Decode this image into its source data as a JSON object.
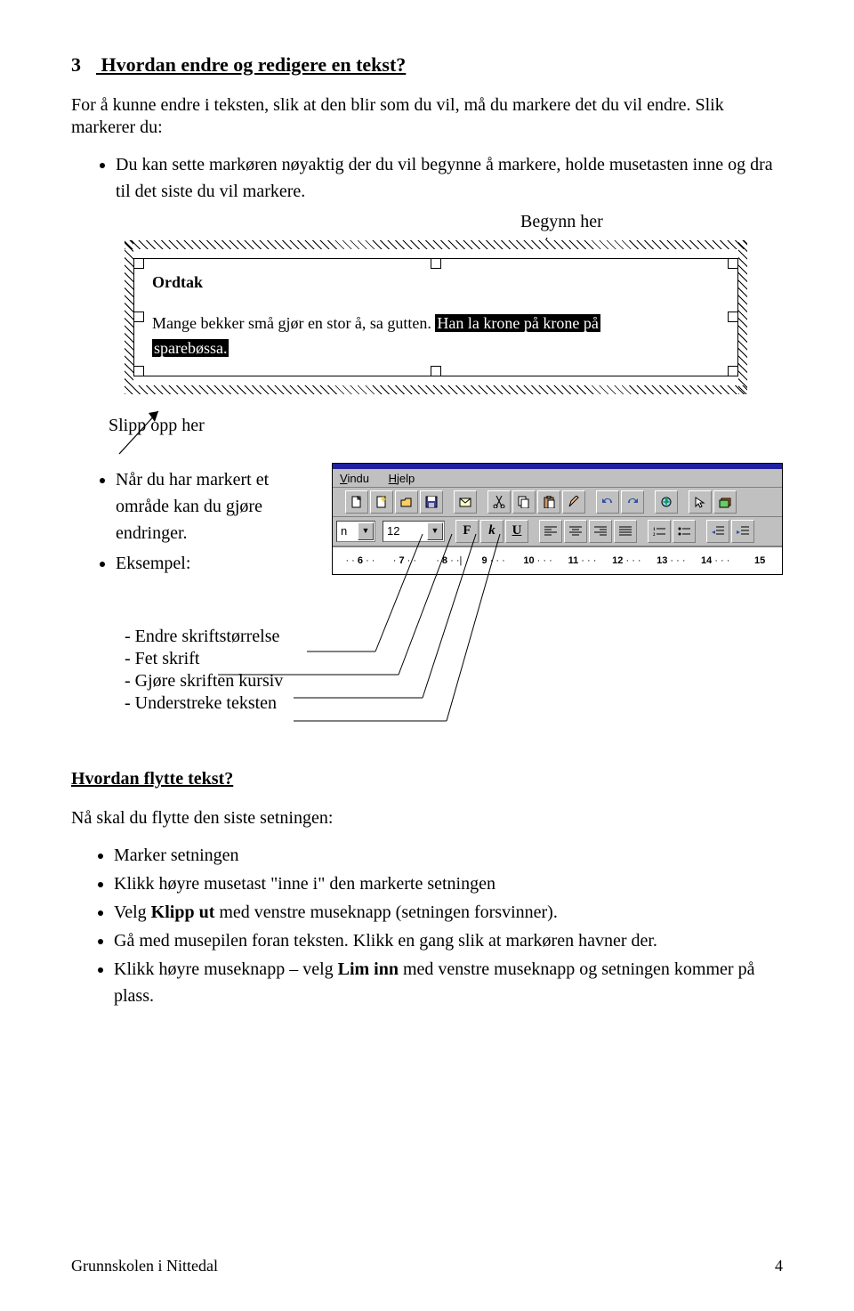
{
  "section_num": "3",
  "section_title": "Hvordan endre og redigere en tekst?",
  "intro": "For å kunne endre i teksten, slik at den blir som du vil, må du markere det du vil endre. Slik markerer du:",
  "bullet1": "Du kan sette markøren nøyaktig der du vil begynne å markere, holde musetasten inne og dra til det siste du vil markere.",
  "label_begynn": "Begynn her",
  "textbox": {
    "title": "Ordtak",
    "line_plain": "Mange bekker små gjør en stor å, sa gutten. ",
    "line_sel1": "Han la krone på krone på",
    "line_sel2": "sparebøssa."
  },
  "label_slipp": "Slipp opp her",
  "bullet2a": "Når du har markert et område kan du gjøre endringer.",
  "bullet2b": "Eksempel:",
  "toolbar": {
    "menu1": "Vindu",
    "menu2": "Hjelp",
    "fontsize": "12",
    "bold": "F",
    "italic": "k",
    "underline": "U",
    "ruler": [
      "6",
      "7",
      "8",
      "9",
      "10",
      "11",
      "12",
      "13",
      "14",
      "15"
    ]
  },
  "format_list": {
    "l1": "- Endre skriftstørrelse",
    "l2": "- Fet skrift",
    "l3": "- Gjøre skriften kursiv",
    "l4": "- Understreke teksten"
  },
  "h2": "Hvordan flytte tekst?",
  "move_intro": "Nå skal du  flytte den siste setningen:",
  "move_bullets": {
    "b1": "Marker setningen",
    "b2_a": "Klikk høyre musetast \"inne i\" den markerte setningen",
    "b3_a": "Velg ",
    "b3_b": "Klipp ut",
    "b3_c": " med venstre museknapp (setningen forsvinner).",
    "b4": "Gå med musepilen foran teksten. Klikk en gang slik at markøren havner der.",
    "b5_a": "Klikk høyre museknapp – velg ",
    "b5_b": "Lim inn",
    "b5_c": " med venstre museknapp og setningen kommer på plass."
  },
  "footer_left": "Grunnskolen i Nittedal",
  "footer_right": "4"
}
